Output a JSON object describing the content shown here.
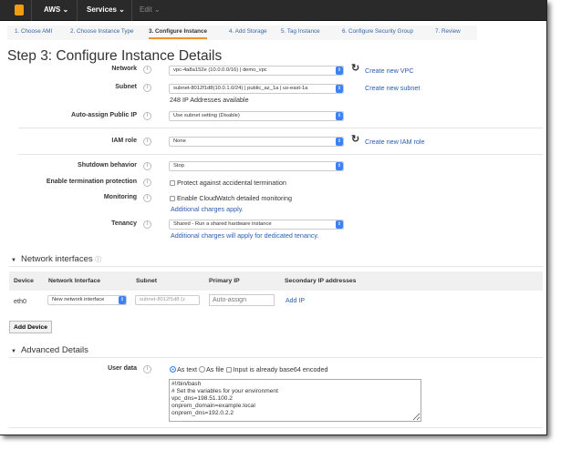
{
  "topbar": {
    "logo": "aws-cube-logo",
    "aws": "AWS ⌄",
    "services": "Services ⌄",
    "edit": "Edit ⌄"
  },
  "tabs": [
    "1. Choose AMI",
    "2. Choose Instance Type",
    "3. Configure Instance",
    "4. Add Storage",
    "5. Tag Instance",
    "6. Configure Security Group",
    "7. Review"
  ],
  "title": "Step 3: Configure Instance Details",
  "fields": {
    "network": {
      "label": "Network",
      "value": "vpc-4a8a152e (10.0.0.0/16) | demo_vpc",
      "link": "Create new VPC"
    },
    "subnet": {
      "label": "Subnet",
      "value": "subnet-8012f1d8(10.0.1.0/24) | public_az_1a | us-east-1a",
      "link": "Create new subnet",
      "note": "248 IP Addresses available"
    },
    "public_ip": {
      "label": "Auto-assign Public IP",
      "value": "Use subnet setting (Disable)"
    },
    "iam": {
      "label": "IAM role",
      "value": "None",
      "link": "Create new IAM role"
    },
    "shutdown": {
      "label": "Shutdown behavior",
      "value": "Stop"
    },
    "termination": {
      "label": "Enable termination protection",
      "checkbox": "Protect against accidental termination",
      "checked": false
    },
    "monitoring": {
      "label": "Monitoring",
      "checkbox": "Enable CloudWatch detailed monitoring",
      "checked": false,
      "link": "Additional charges apply."
    },
    "tenancy": {
      "label": "Tenancy",
      "value": "Shared - Run a shared hardware instance",
      "link": "Additional charges will apply for dedicated tenancy."
    }
  },
  "network_interfaces": {
    "title": "Network interfaces",
    "headers": [
      "Device",
      "Network Interface",
      "Subnet",
      "Primary IP",
      "Secondary IP addresses"
    ],
    "row": {
      "device": "eth0",
      "interface": "New network interface",
      "subnet": "subnet-8012f1d8 (z",
      "primary_ip_placeholder": "Auto-assign",
      "add_ip": "Add IP"
    },
    "add_device": "Add Device"
  },
  "advanced": {
    "title": "Advanced Details",
    "user_data_label": "User data",
    "as_text": "As text",
    "as_file": "As file",
    "base64": "Input is already base64 encoded",
    "selected": "As text",
    "user_data": "#!/bin/bash\n# Set the variables for your environment\nvpc_dns=198.51.100.2\nonprem_domain=example.local\nonprem_dns=192.0.2.2"
  },
  "colors": {
    "accent": "#f0932b",
    "link": "#2a5db0",
    "topbar": "#2a2a2a"
  }
}
